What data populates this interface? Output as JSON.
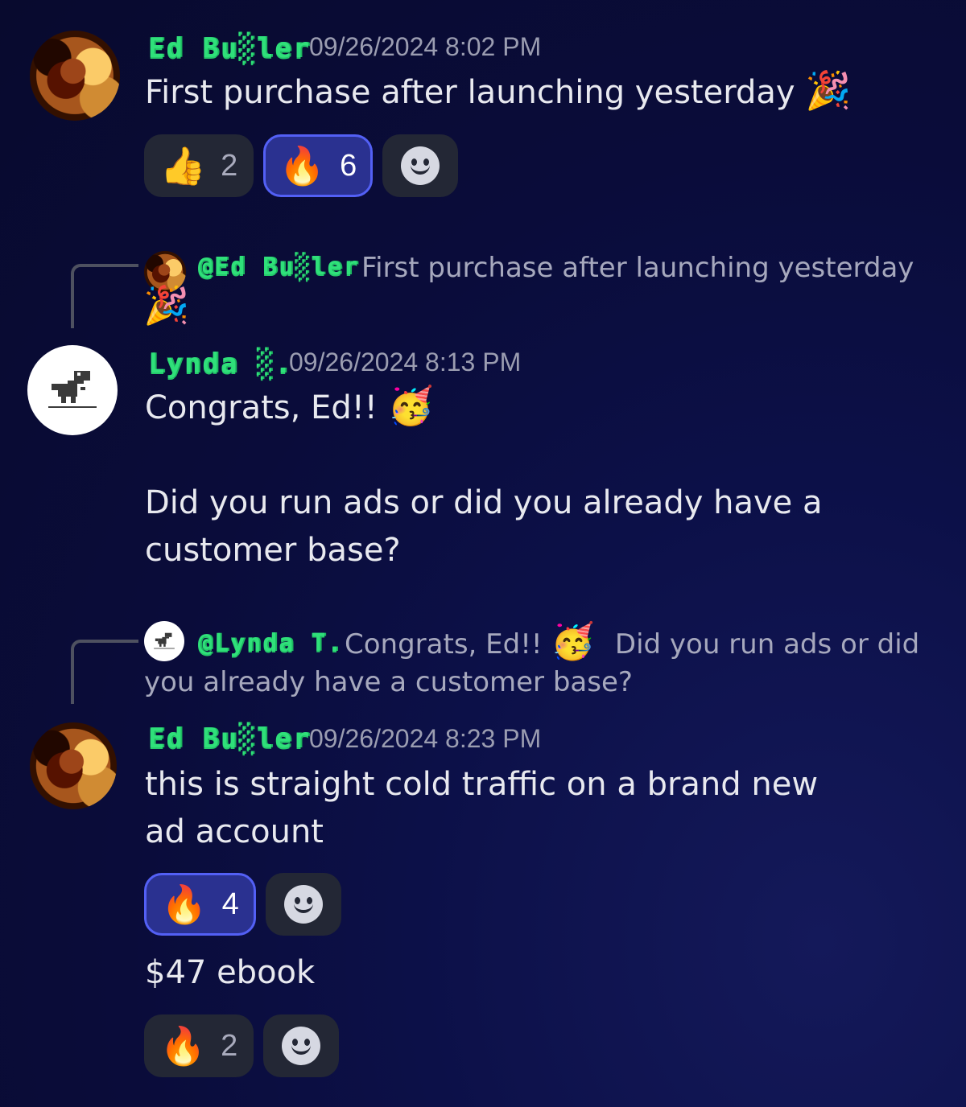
{
  "messages": [
    {
      "username": "Ed Bu░ler",
      "timestamp": "09/26/2024 8:02 PM",
      "text": "First purchase after launching yesterday",
      "text_emoji": "🎉",
      "reactions": [
        {
          "emoji": "👍",
          "count": "2",
          "active": false
        },
        {
          "emoji": "🔥",
          "count": "6",
          "active": true
        }
      ]
    },
    {
      "reply": {
        "username": "@Ed Bu░ler",
        "text": "First purchase after launching yesterday",
        "emoji": "🎉"
      },
      "username": "Lynda ░.",
      "timestamp": "09/26/2024 8:13 PM",
      "text_line1": "Congrats, Ed!!",
      "text_emoji": "🥳",
      "text_line2": "Did you run ads or did you already have a customer base?"
    },
    {
      "reply": {
        "username": "@Lynda T.",
        "text_a": "Congrats, Ed!!",
        "emoji": "🥳",
        "text_b": "Did you run ads or did",
        "text_c": "you already have a customer base?"
      },
      "username": "Ed Bu░ler",
      "timestamp": "09/26/2024 8:23 PM",
      "text": "this is straight cold traffic on a brand new ad account",
      "reactions": [
        {
          "emoji": "🔥",
          "count": "4",
          "active": true
        }
      ],
      "followup_text": "$47 ebook",
      "followup_reactions": [
        {
          "emoji": "🔥",
          "count": "2",
          "active": false
        }
      ]
    }
  ],
  "icons": {
    "add_reaction": "smiley-icon",
    "dino": "dino-icon"
  },
  "colors": {
    "username": "#2fe07a",
    "accent": "#5360f5",
    "pill": "#232735"
  }
}
